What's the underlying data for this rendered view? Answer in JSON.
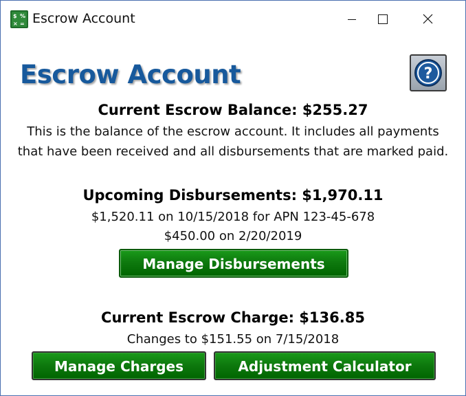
{
  "window": {
    "title": "Escrow Account",
    "controls": [
      "minimize-icon",
      "maximize-icon",
      "close-icon"
    ],
    "accent": "#4a6fb0"
  },
  "header": {
    "heading": "Escrow Account",
    "heading_color": "#17599c",
    "help_icon": "question-icon"
  },
  "balance": {
    "title": "Current Escrow Balance: $255.27",
    "description_line1": "This is the balance of the escrow account. It includes all payments",
    "description_line2": "that have been received and all disbursements that are marked paid."
  },
  "disbursements": {
    "title": "Upcoming Disbursements: $1,970.11",
    "items": [
      "$1,520.11 on 10/15/2018 for APN 123-45-678",
      "$450.00 on 2/20/2019"
    ],
    "manage_button": "Manage Disbursements"
  },
  "charge": {
    "title": "Current Escrow Charge: $136.85",
    "change_note": "Changes to $151.55 on 7/15/2018",
    "manage_button": "Manage Charges",
    "calculator_button": "Adjustment Calculator"
  },
  "colors": {
    "button_green": "#0e7a0e",
    "button_text": "#ffffff"
  }
}
